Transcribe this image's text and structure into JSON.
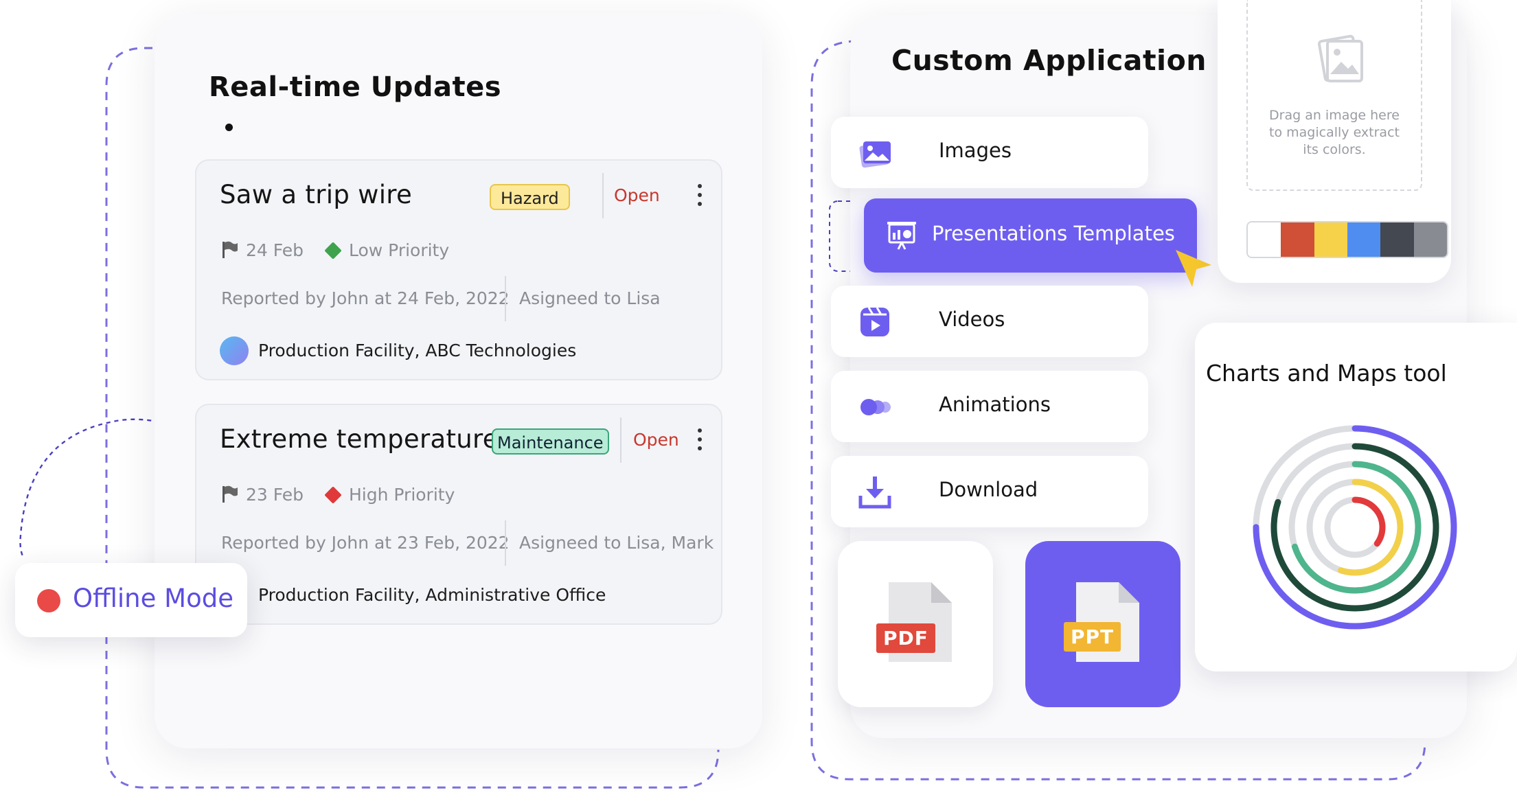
{
  "realtime": {
    "title": "Real-time Updates",
    "cards": [
      {
        "title": "Saw a trip wire",
        "tag": "Hazard",
        "status": "Open",
        "date": "24 Feb",
        "priority": "Low Priority",
        "priority_color": "#3fa34d",
        "reported": "Reported by John at 24 Feb, 2022",
        "assigned": "Asigneed to Lisa",
        "location": "Production Facility, ABC Technologies"
      },
      {
        "title": "Extreme temperature",
        "tag": "Maintenance",
        "status": "Open",
        "date": "23 Feb",
        "priority": "High Priority",
        "priority_color": "#e0393b",
        "reported": "Reported by John at 23 Feb, 2022",
        "assigned": "Asigneed to Lisa, Mark",
        "location": "Production Facility, Administrative Office"
      }
    ]
  },
  "offline": {
    "label": "Offline Mode",
    "dot_color": "#e94a47"
  },
  "custom_app": {
    "title": "Custom Application",
    "menu": [
      {
        "label": "Images",
        "icon": "images-icon"
      },
      {
        "label": "Presentations Templates",
        "icon": "presentation-icon",
        "active": true
      },
      {
        "label": "Videos",
        "icon": "video-icon"
      },
      {
        "label": "Animations",
        "icon": "animation-icon"
      },
      {
        "label": "Download",
        "icon": "download-icon"
      }
    ],
    "files": [
      {
        "label": "PDF",
        "color": "#e0493b"
      },
      {
        "label": "PPT",
        "color": "#f2b632"
      }
    ]
  },
  "image_drop": {
    "text_line1": "Drag an image here",
    "text_line2": "to magically extract",
    "text_line3": "its colors.",
    "palette": [
      "#ffffff",
      "#cf4f37",
      "#f6d24a",
      "#4f8df0",
      "#444851",
      "#888b92"
    ]
  },
  "charts": {
    "title": "Charts and Maps tool",
    "ring_colors": [
      "#6e5ef0",
      "#1f4a3a",
      "#4fb58d",
      "#f2d04a",
      "#e2393b"
    ],
    "ring_fractions": [
      0.75,
      0.8,
      0.7,
      0.55,
      0.35
    ]
  },
  "accent_color": "#6e5ef0"
}
